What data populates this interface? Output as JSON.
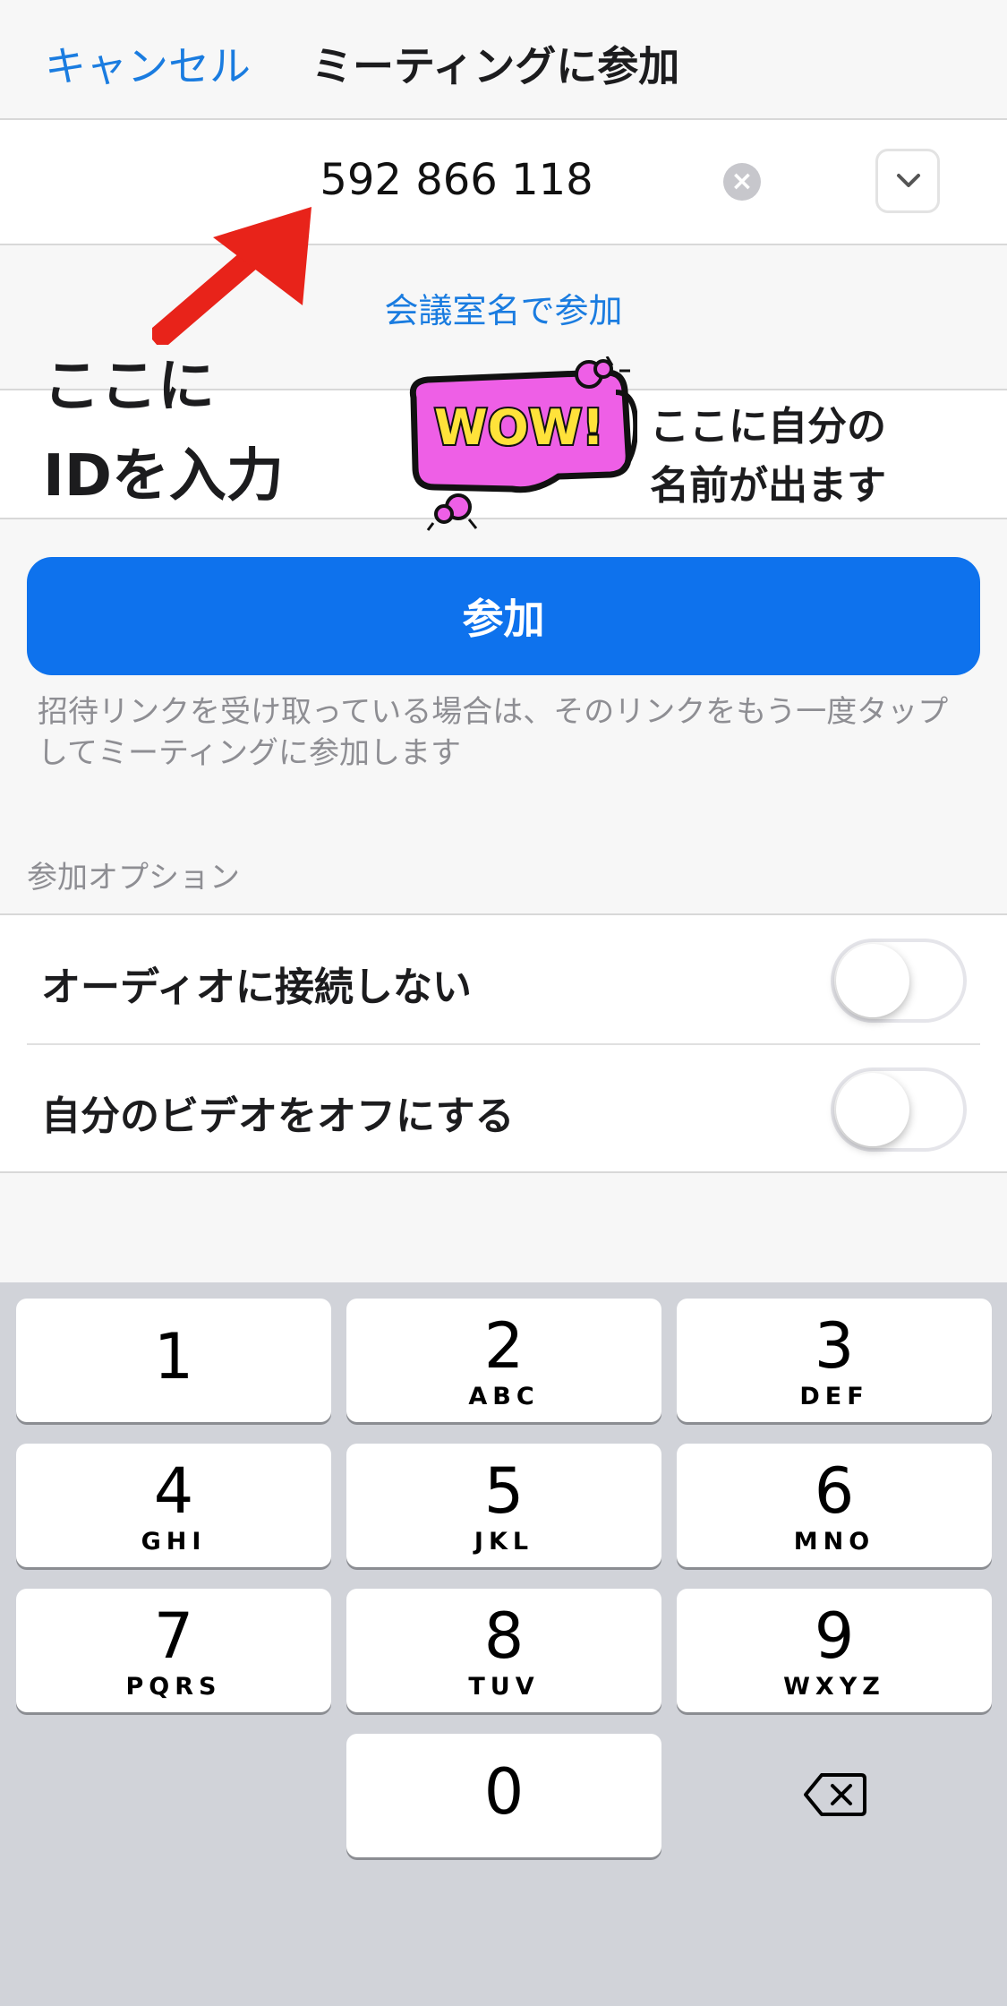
{
  "header": {
    "cancel_label": "キャンセル",
    "title": "ミーティングに参加"
  },
  "meeting_id": {
    "value": "592 866 118",
    "clear_icon": "clear-icon",
    "history_icon": "chevron-down-icon"
  },
  "room_name_link": "会議室名で参加",
  "annotations": {
    "id_hint_lines": [
      "ここに",
      "IDを入力"
    ],
    "name_hint_lines": [
      "ここに自分の",
      "名前が出ます"
    ],
    "wow_text": "WOW!"
  },
  "join_button": "参加",
  "hint_text": "招待リンクを受け取っている場合は、そのリンクをもう一度タップしてミーティングに参加します",
  "options": {
    "header": "参加オプション",
    "items": [
      {
        "label": "オーディオに接続しない",
        "enabled": false
      },
      {
        "label": "自分のビデオをオフにする",
        "enabled": false
      }
    ]
  },
  "keypad": {
    "keys": [
      {
        "num": "1",
        "letters": ""
      },
      {
        "num": "2",
        "letters": "ABC"
      },
      {
        "num": "3",
        "letters": "DEF"
      },
      {
        "num": "4",
        "letters": "GHI"
      },
      {
        "num": "5",
        "letters": "JKL"
      },
      {
        "num": "6",
        "letters": "MNO"
      },
      {
        "num": "7",
        "letters": "PQRS"
      },
      {
        "num": "8",
        "letters": "TUV"
      },
      {
        "num": "9",
        "letters": "WXYZ"
      },
      {
        "num": "0",
        "letters": ""
      }
    ],
    "backspace_icon": "backspace-icon"
  },
  "colors": {
    "accent": "#1a7ce0",
    "join_button": "#0e72ed",
    "keypad_bg": "#d1d3d9",
    "arrow": "#e8231a",
    "wow_bubble": "#ee5fe6"
  }
}
